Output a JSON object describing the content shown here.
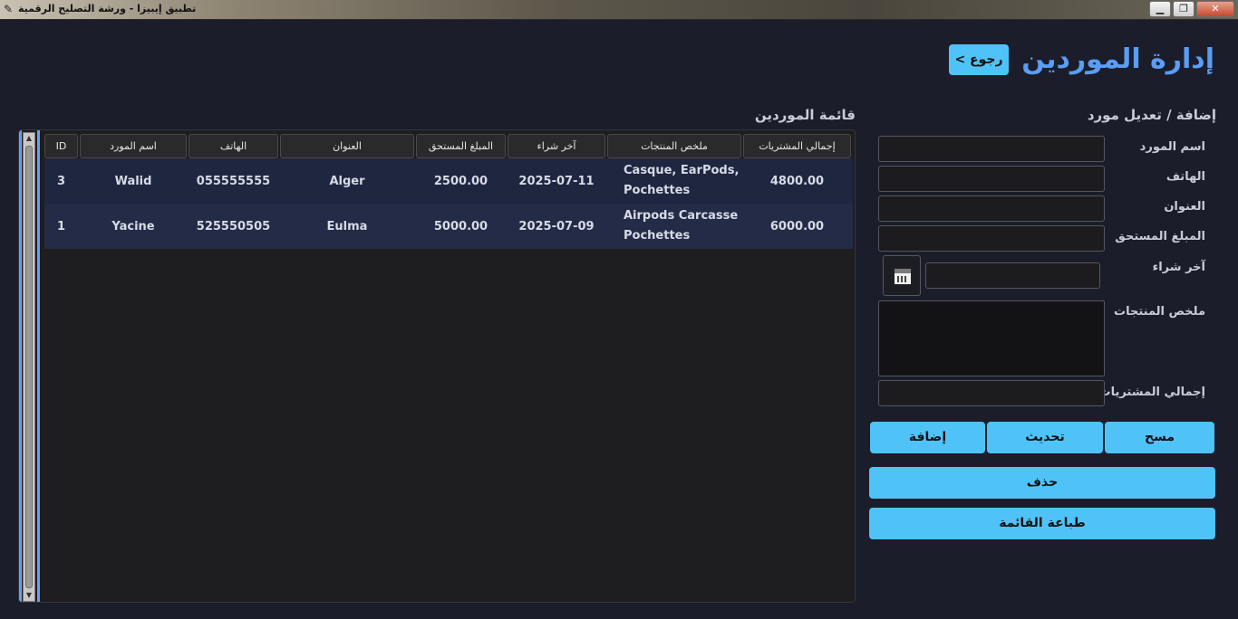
{
  "window": {
    "title": "تطبيق إيبيزا - ورشة التصليح الرقمية",
    "controls": [
      "▁",
      "❐",
      "✕"
    ]
  },
  "header": {
    "title": "إدارة الموردين",
    "back_label": "< رجوع"
  },
  "form": {
    "heading": "إضافة / تعديل مورد",
    "labels": {
      "name": "اسم المورد",
      "phone": "الهاتف",
      "address": "العنوان",
      "due": "المبلغ المستحق",
      "last_purchase": "آخر شراء",
      "products": "ملخص المنتجات",
      "total": "إجمالي المشتريات"
    },
    "values": {
      "name": "",
      "phone": "",
      "address": "",
      "due": "",
      "last_purchase": "",
      "products": "",
      "total": ""
    },
    "buttons": {
      "clear": "مسح",
      "update": "تحديث",
      "add": "إضافة",
      "delete": "حذف",
      "print": "طباعة القائمة"
    }
  },
  "list": {
    "heading": "قائمة الموردين",
    "columns": [
      "ID",
      "اسم المورد",
      "الهاتف",
      "العنوان",
      "المبلغ المستحق",
      "آخر شراء",
      "ملخص المنتجات",
      "إجمالي المشتريات"
    ],
    "rows": [
      {
        "id": "3",
        "name": "Walid",
        "phone": "055555555",
        "address": "Alger",
        "due": "2500.00",
        "last": "2025-07-11",
        "products_1": "Casque, EarPods,",
        "products_2": "Pochettes",
        "total": "4800.00"
      },
      {
        "id": "1",
        "name": "Yacine",
        "phone": "525550505",
        "address": "Eulma",
        "due": "5000.00",
        "last": "2025-07-09",
        "products_1": "Airpods Carcasse",
        "products_2": "Pochettes",
        "total": "6000.00"
      }
    ]
  },
  "colors": {
    "background": "#1b1d2a",
    "accent": "#4fc3f7",
    "title": "#5a9df5",
    "row_highlight": "#1f2640"
  }
}
